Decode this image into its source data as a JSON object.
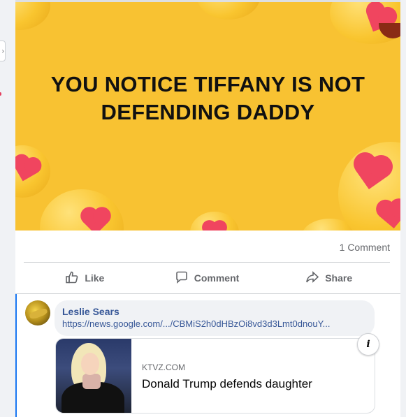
{
  "post": {
    "image_text": "YOU NOTICE TIFFANY IS NOT DEFENDING DADDY",
    "comment_count": "1 Comment"
  },
  "actions": {
    "like": "Like",
    "comment": "Comment",
    "share": "Share"
  },
  "comment": {
    "author": "Leslie Sears",
    "url": "https://news.google.com/.../CBMiS2h0dHBzOi8vd3d3Lmt0dnouY...",
    "link_preview": {
      "domain": "KTVZ.COM",
      "title": "Donald Trump defends daughter"
    },
    "info_label": "i"
  },
  "colors": {
    "image_bg": "#f8c232",
    "heart": "#f0455f",
    "link": "#385898",
    "muted": "#65676b"
  },
  "icons": [
    "thumbs-up-icon",
    "comment-icon",
    "share-icon",
    "info-icon"
  ]
}
